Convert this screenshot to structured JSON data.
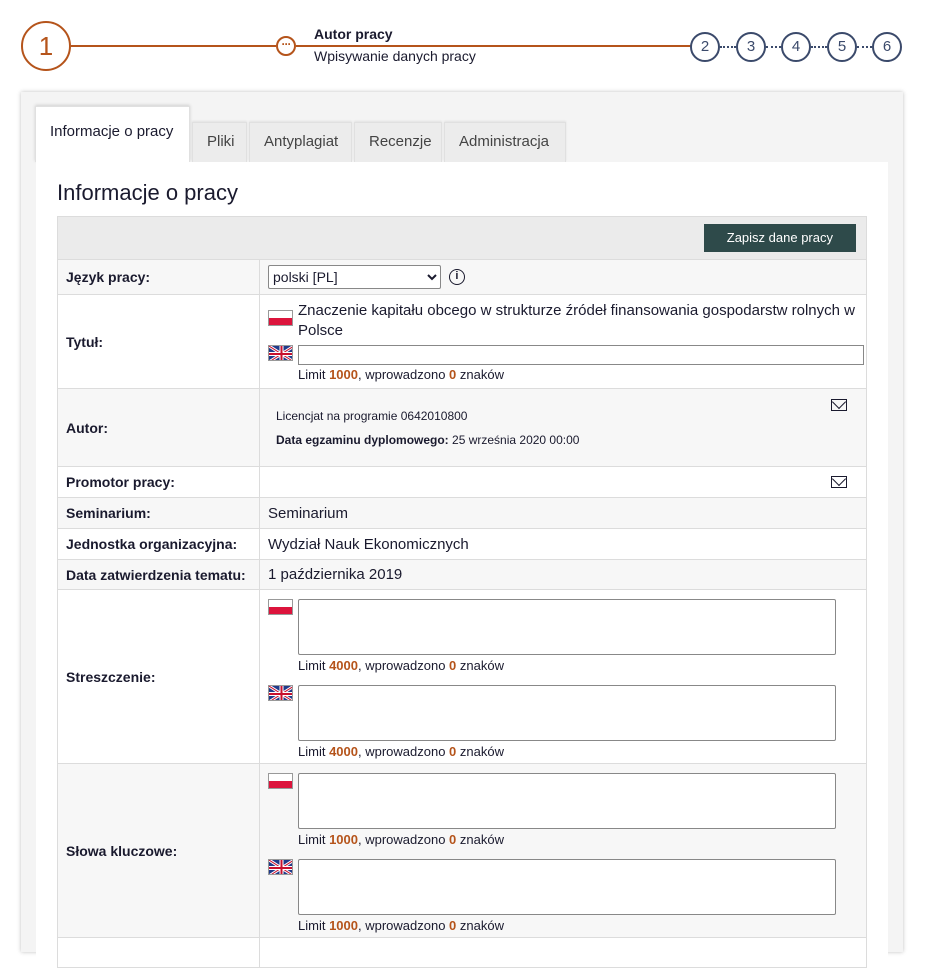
{
  "stepper": {
    "current_step": "1",
    "current_title": "Autor pracy",
    "current_subtitle": "Wpisywanie danych pracy",
    "steps": [
      "2",
      "3",
      "4",
      "5",
      "6"
    ]
  },
  "tabs": [
    "Informacje o pracy",
    "Pliki",
    "Antyplagiat",
    "Recenzje",
    "Administracja"
  ],
  "panel": {
    "title": "Informacje o pracy",
    "save_button": "Zapisz dane pracy"
  },
  "rows": {
    "language": {
      "label": "Język pracy:",
      "selected": "polski [PL]"
    },
    "title": {
      "label": "Tytuł:",
      "pl_value": "Znaczenie kapitału obcego w strukturze źródeł finansowania gospodarstw rolnych w Polsce",
      "en_value": "",
      "limit_prefix": "Limit ",
      "limit": "1000",
      "limit_mid": ", wprowadzono ",
      "entered": "0",
      "limit_suffix": " znaków"
    },
    "author": {
      "label": "Autor:",
      "program": "Licencjat na programie 0642010800",
      "exam_label": "Data egzaminu dyplomowego:",
      "exam_date": "25 września 2020 00:00"
    },
    "supervisor": {
      "label": "Promotor pracy:"
    },
    "seminar": {
      "label": "Seminarium:",
      "value": "Seminarium"
    },
    "unit": {
      "label": "Jednostka organizacyjna:",
      "value": "Wydział Nauk Ekonomicznych"
    },
    "approval_date": {
      "label": "Data zatwierdzenia tematu:",
      "value": "1 października 2019"
    },
    "abstract": {
      "label": "Streszczenie:",
      "limit": "4000",
      "entered": "0"
    },
    "keywords": {
      "label": "Słowa kluczowe:",
      "limit": "1000",
      "entered": "0"
    }
  },
  "limit_text": {
    "prefix": "Limit ",
    "mid": ", wprowadzono ",
    "suffix": " znaków"
  },
  "colors": {
    "accent": "#b5541b",
    "step_inactive": "#3b4a6b",
    "button_bg": "#2e4a4a"
  },
  "icons": [
    "info-icon",
    "mail-icon",
    "flag-pl-icon",
    "flag-uk-icon"
  ]
}
